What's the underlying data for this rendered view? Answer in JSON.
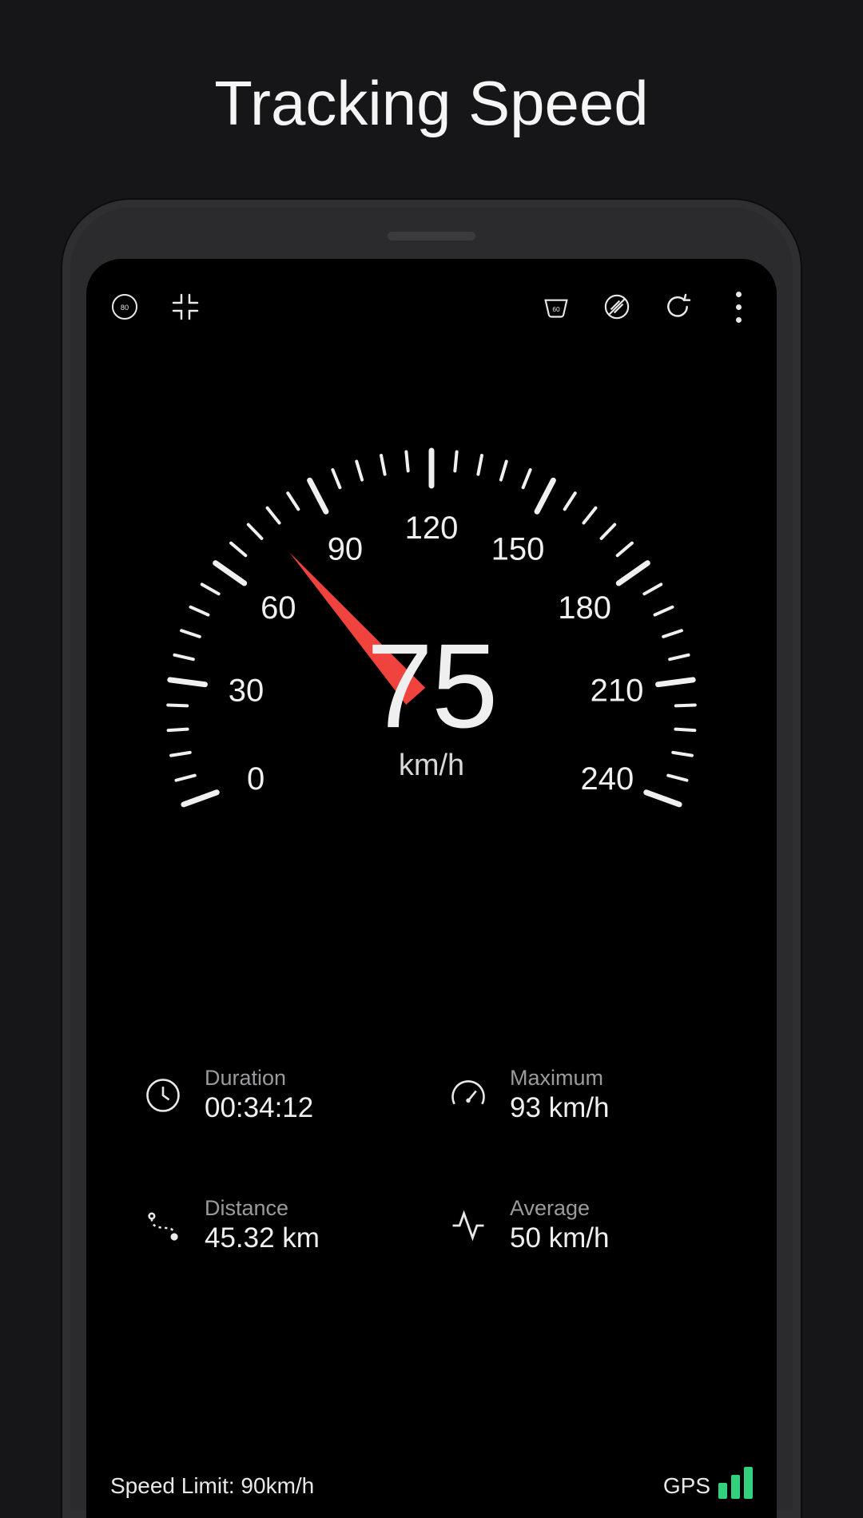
{
  "page_title": "Tracking Speed",
  "gauge": {
    "speed": 75,
    "unit": "km/h",
    "min": 0,
    "max": 240,
    "major_step": 30,
    "minor_step": 6
  },
  "stats": {
    "duration": {
      "label": "Duration",
      "value": "00:34:12"
    },
    "maximum": {
      "label": "Maximum",
      "value": "93 km/h"
    },
    "distance": {
      "label": "Distance",
      "value": "45.32 km"
    },
    "average": {
      "label": "Average",
      "value": "50 km/h"
    }
  },
  "footer": {
    "speed_limit": "Speed Limit: 90km/h",
    "gps_label": "GPS",
    "gps_bars": 3
  },
  "colors": {
    "needle": "#f0433d",
    "tick": "#f0f0f0",
    "gps_bar": "#34d17c"
  }
}
